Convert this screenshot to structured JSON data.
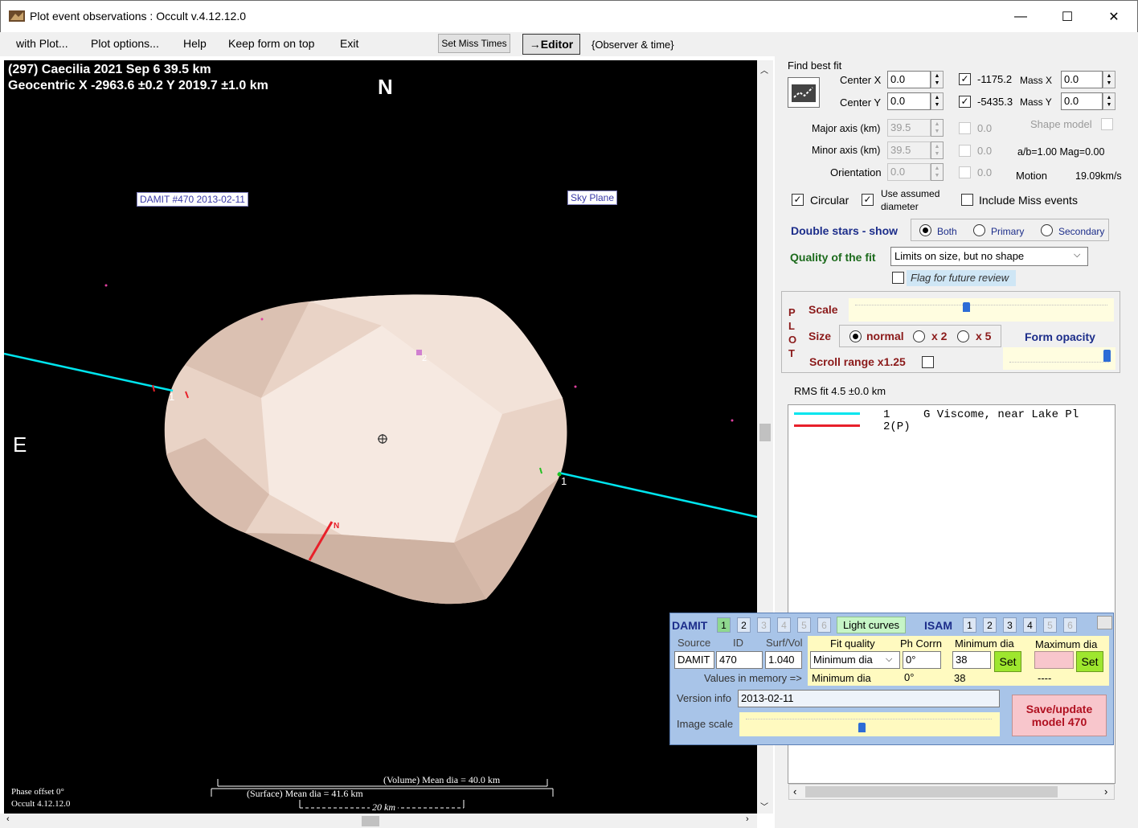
{
  "window": {
    "title": "Plot event observations : Occult v.4.12.12.0",
    "min": "—",
    "max": "☐",
    "close": "✕"
  },
  "menu": {
    "items": [
      "with Plot...",
      "Plot options...",
      "Help",
      "Keep form on top",
      "Exit"
    ],
    "set_miss_times": "Set Miss Times",
    "editor": "→Editor",
    "observer_time": "{Observer & time}"
  },
  "plot": {
    "header_line1": "(297) Caecilia  2021 Sep 6   39.5 km",
    "header_line2": "Geocentric  X  -2963.6 ±0.2  Y 2019.7 ±1.0 km",
    "north": "N",
    "east": "E",
    "damit_label": "DAMIT #470 2013-02-11",
    "sky_plane": "Sky Plane",
    "chord_label_1a": "1",
    "chord_label_1b": "1",
    "chord_label_2": "2",
    "pole_label": "N",
    "volume_dia": "(Volume) Mean dia = 40.0 km",
    "surface_dia": "(Surface) Mean dia = 41.6 km",
    "scale_bar": "20 km",
    "phase_offset": "Phase offset 0°",
    "occult_version": "Occult 4.12.12.0"
  },
  "fit": {
    "find_best_fit": "Find best fit",
    "center_x_label": "Center X",
    "center_x": "0.0",
    "center_y_label": "Center Y",
    "center_y": "0.0",
    "x_value": "-1175.2",
    "y_value": "-5435.3",
    "mass_x_label": "Mass X",
    "mass_x": "0.0",
    "mass_y_label": "Mass Y",
    "mass_y": "0.0",
    "major_label": "Major axis (km)",
    "major": "39.5",
    "major_cb": "0.0",
    "minor_label": "Minor axis (km)",
    "minor": "39.5",
    "minor_cb": "0.0",
    "orient_label": "Orientation",
    "orient": "0.0",
    "orient_cb": "0.0",
    "shape_model": "Shape model",
    "ab_mag": "a/b=1.00  Mag=0.00",
    "motion_label": "Motion",
    "motion": "19.09km/s",
    "circular": "Circular",
    "use_assumed": "Use assumed",
    "diameter": "diameter",
    "include_miss": "Include Miss events",
    "double_stars": "Double stars - show",
    "both": "Both",
    "primary": "Primary",
    "secondary": "Secondary",
    "quality_label": "Quality of the fit",
    "quality_value": "Limits on size, but no shape",
    "flag_review": "Flag for future review"
  },
  "plotpanel": {
    "side_letters": [
      "P",
      "L",
      "O",
      "T"
    ],
    "scale": "Scale",
    "size": "Size",
    "normal": "normal",
    "x2": "x 2",
    "x5": "x 5",
    "form_opacity": "Form opacity",
    "scroll_range": "Scroll range x1.25"
  },
  "rms": "RMS fit 4.5 ±0.0 km",
  "legend": [
    {
      "num": "1",
      "text": "G Viscome, near Lake Pl",
      "color": "#00e5ee"
    },
    {
      "num": "2(P)",
      "text": "",
      "color": "#e8202a"
    }
  ],
  "damit": {
    "title": "DAMIT",
    "nums": [
      "1",
      "2",
      "3",
      "4",
      "5",
      "6"
    ],
    "light_curves": "Light curves",
    "isam": "ISAM",
    "isam_nums": [
      "1",
      "2",
      "3",
      "4",
      "5",
      "6"
    ],
    "source_label": "Source",
    "id_label": "ID",
    "surfvol_label": "Surf/Vol",
    "source": "DAMIT",
    "id": "470",
    "surfvol": "1.040",
    "fitq_label": "Fit quality",
    "phcorr_label": "Ph Corrn",
    "mindia_label": "Minimum dia",
    "maxdia_label": "Maximum dia",
    "fitq_value": "Minimum dia",
    "phcorr_value": "0°",
    "mindia_value": "38",
    "maxdia_value": "",
    "set": "Set",
    "values_memory": "Values in memory =>",
    "mem_fitq": "Minimum dia",
    "mem_phcorr": "0°",
    "mem_min": "38",
    "mem_max": "----",
    "version_label": "Version info",
    "version_value": "2013-02-11",
    "image_scale": "Image scale",
    "save_update": "Save/update",
    "model": "model 470"
  },
  "colors": {
    "chord": "#00e5ee",
    "miss": "#e8202a",
    "shape": "#e9d3c6",
    "damit_bg": "#a8c4e8"
  }
}
